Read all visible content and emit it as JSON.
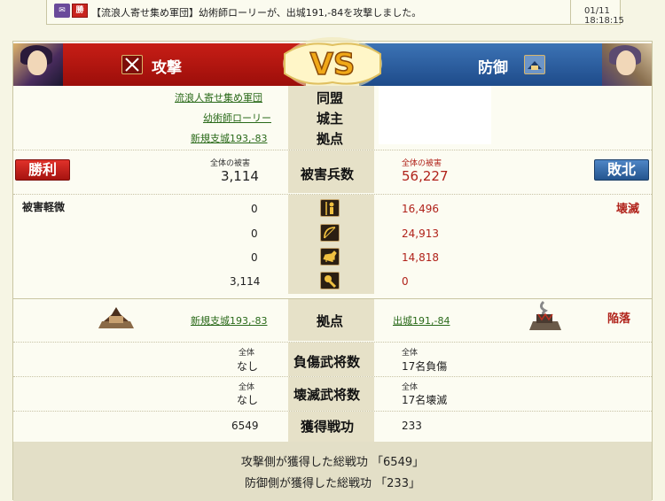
{
  "notice": {
    "win_badge": "勝",
    "message": "【流浪人寄せ集め軍団】幼術師ローリーが、出城191,-84を攻撃しました。",
    "timestamp": "01/11 18:18:15"
  },
  "header": {
    "attack_label": "攻撃",
    "defense_label": "防御",
    "vs_label": "VS"
  },
  "info": {
    "alliance_label": "同盟",
    "lord_label": "城主",
    "base_label": "拠点",
    "attacker_alliance": "流浪人寄せ集め軍団",
    "attacker_lord": "幼術師ローリー",
    "attacker_base": "新規支城193,-83"
  },
  "casualties": {
    "attacker_result": "勝利",
    "defender_result": "敗北",
    "total_caption": "全体の被害",
    "label": "被害兵数",
    "attacker_total": "3,114",
    "defender_total": "56,227"
  },
  "units": {
    "attacker_status": "被害軽微",
    "defender_status": "壊滅",
    "rows": [
      {
        "icon": "spear-infantry-icon",
        "attacker": "0",
        "defender": "16,496"
      },
      {
        "icon": "bow-archer-icon",
        "attacker": "0",
        "defender": "24,913"
      },
      {
        "icon": "horse-cavalry-icon",
        "attacker": "0",
        "defender": "14,818"
      },
      {
        "icon": "siege-weapon-icon",
        "attacker": "3,114",
        "defender": "0"
      }
    ]
  },
  "base_row": {
    "label": "拠点",
    "attacker_base": "新規支城193,-83",
    "defender_base": "出城191,-84",
    "defender_status": "陥落"
  },
  "injured": {
    "caption": "全体",
    "label": "負傷武将数",
    "attacker": "なし",
    "defender": "17名負傷"
  },
  "destroyed": {
    "caption": "全体",
    "label": "壊滅武将数",
    "attacker": "なし",
    "defender": "17名壊滅"
  },
  "merit": {
    "label": "獲得戦功",
    "attacker": "6549",
    "defender": "233"
  },
  "footer": {
    "attacker_total": "攻撃側が獲得した総戦功 「6549」",
    "defender_total": "防御側が獲得した総戦功 「233」"
  }
}
